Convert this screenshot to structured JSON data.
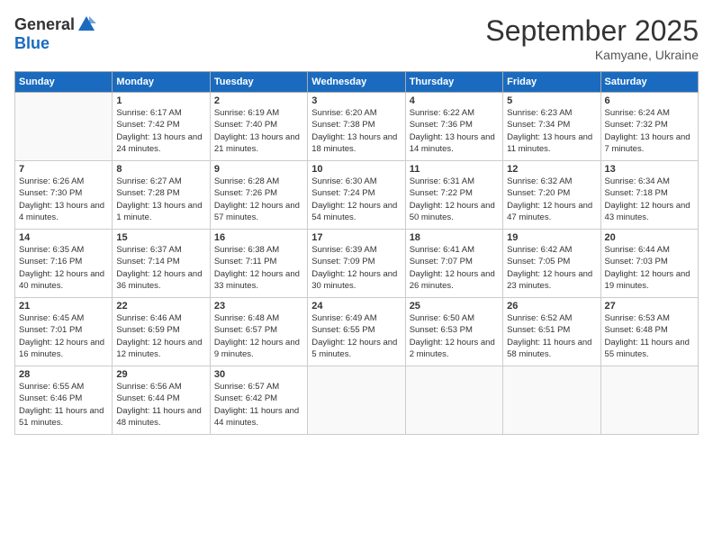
{
  "header": {
    "logo_general": "General",
    "logo_blue": "Blue",
    "month_title": "September 2025",
    "location": "Kamyane, Ukraine"
  },
  "days_of_week": [
    "Sunday",
    "Monday",
    "Tuesday",
    "Wednesday",
    "Thursday",
    "Friday",
    "Saturday"
  ],
  "weeks": [
    [
      {
        "day": "",
        "info": ""
      },
      {
        "day": "1",
        "info": "Sunrise: 6:17 AM\nSunset: 7:42 PM\nDaylight: 13 hours and 24 minutes."
      },
      {
        "day": "2",
        "info": "Sunrise: 6:19 AM\nSunset: 7:40 PM\nDaylight: 13 hours and 21 minutes."
      },
      {
        "day": "3",
        "info": "Sunrise: 6:20 AM\nSunset: 7:38 PM\nDaylight: 13 hours and 18 minutes."
      },
      {
        "day": "4",
        "info": "Sunrise: 6:22 AM\nSunset: 7:36 PM\nDaylight: 13 hours and 14 minutes."
      },
      {
        "day": "5",
        "info": "Sunrise: 6:23 AM\nSunset: 7:34 PM\nDaylight: 13 hours and 11 minutes."
      },
      {
        "day": "6",
        "info": "Sunrise: 6:24 AM\nSunset: 7:32 PM\nDaylight: 13 hours and 7 minutes."
      }
    ],
    [
      {
        "day": "7",
        "info": "Sunrise: 6:26 AM\nSunset: 7:30 PM\nDaylight: 13 hours and 4 minutes."
      },
      {
        "day": "8",
        "info": "Sunrise: 6:27 AM\nSunset: 7:28 PM\nDaylight: 13 hours and 1 minute."
      },
      {
        "day": "9",
        "info": "Sunrise: 6:28 AM\nSunset: 7:26 PM\nDaylight: 12 hours and 57 minutes."
      },
      {
        "day": "10",
        "info": "Sunrise: 6:30 AM\nSunset: 7:24 PM\nDaylight: 12 hours and 54 minutes."
      },
      {
        "day": "11",
        "info": "Sunrise: 6:31 AM\nSunset: 7:22 PM\nDaylight: 12 hours and 50 minutes."
      },
      {
        "day": "12",
        "info": "Sunrise: 6:32 AM\nSunset: 7:20 PM\nDaylight: 12 hours and 47 minutes."
      },
      {
        "day": "13",
        "info": "Sunrise: 6:34 AM\nSunset: 7:18 PM\nDaylight: 12 hours and 43 minutes."
      }
    ],
    [
      {
        "day": "14",
        "info": "Sunrise: 6:35 AM\nSunset: 7:16 PM\nDaylight: 12 hours and 40 minutes."
      },
      {
        "day": "15",
        "info": "Sunrise: 6:37 AM\nSunset: 7:14 PM\nDaylight: 12 hours and 36 minutes."
      },
      {
        "day": "16",
        "info": "Sunrise: 6:38 AM\nSunset: 7:11 PM\nDaylight: 12 hours and 33 minutes."
      },
      {
        "day": "17",
        "info": "Sunrise: 6:39 AM\nSunset: 7:09 PM\nDaylight: 12 hours and 30 minutes."
      },
      {
        "day": "18",
        "info": "Sunrise: 6:41 AM\nSunset: 7:07 PM\nDaylight: 12 hours and 26 minutes."
      },
      {
        "day": "19",
        "info": "Sunrise: 6:42 AM\nSunset: 7:05 PM\nDaylight: 12 hours and 23 minutes."
      },
      {
        "day": "20",
        "info": "Sunrise: 6:44 AM\nSunset: 7:03 PM\nDaylight: 12 hours and 19 minutes."
      }
    ],
    [
      {
        "day": "21",
        "info": "Sunrise: 6:45 AM\nSunset: 7:01 PM\nDaylight: 12 hours and 16 minutes."
      },
      {
        "day": "22",
        "info": "Sunrise: 6:46 AM\nSunset: 6:59 PM\nDaylight: 12 hours and 12 minutes."
      },
      {
        "day": "23",
        "info": "Sunrise: 6:48 AM\nSunset: 6:57 PM\nDaylight: 12 hours and 9 minutes."
      },
      {
        "day": "24",
        "info": "Sunrise: 6:49 AM\nSunset: 6:55 PM\nDaylight: 12 hours and 5 minutes."
      },
      {
        "day": "25",
        "info": "Sunrise: 6:50 AM\nSunset: 6:53 PM\nDaylight: 12 hours and 2 minutes."
      },
      {
        "day": "26",
        "info": "Sunrise: 6:52 AM\nSunset: 6:51 PM\nDaylight: 11 hours and 58 minutes."
      },
      {
        "day": "27",
        "info": "Sunrise: 6:53 AM\nSunset: 6:48 PM\nDaylight: 11 hours and 55 minutes."
      }
    ],
    [
      {
        "day": "28",
        "info": "Sunrise: 6:55 AM\nSunset: 6:46 PM\nDaylight: 11 hours and 51 minutes."
      },
      {
        "day": "29",
        "info": "Sunrise: 6:56 AM\nSunset: 6:44 PM\nDaylight: 11 hours and 48 minutes."
      },
      {
        "day": "30",
        "info": "Sunrise: 6:57 AM\nSunset: 6:42 PM\nDaylight: 11 hours and 44 minutes."
      },
      {
        "day": "",
        "info": ""
      },
      {
        "day": "",
        "info": ""
      },
      {
        "day": "",
        "info": ""
      },
      {
        "day": "",
        "info": ""
      }
    ]
  ]
}
